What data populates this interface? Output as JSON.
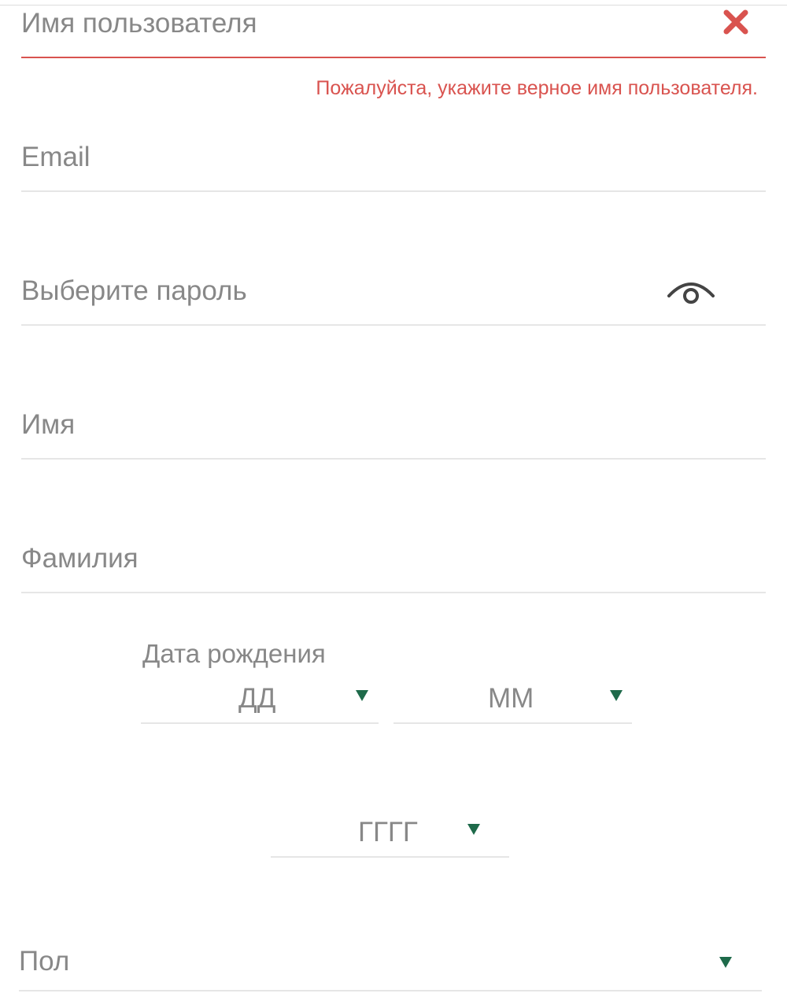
{
  "form": {
    "username": {
      "placeholder": "Имя пользователя",
      "error": "Пожалуйста, укажите верное имя пользователя."
    },
    "email": {
      "placeholder": "Email"
    },
    "password": {
      "placeholder": "Выберите пароль"
    },
    "first_name": {
      "placeholder": "Имя"
    },
    "last_name": {
      "placeholder": "Фамилия"
    },
    "dob": {
      "label": "Дата рождения",
      "day": "ДД",
      "month": "ММ",
      "year": "ГГГГ"
    },
    "gender": {
      "placeholder": "Пол"
    }
  },
  "icons": {
    "clear": "close-icon",
    "password_toggle": "eye-icon",
    "dropdown": "triangle-down-icon"
  },
  "colors": {
    "error": "#d9534f",
    "placeholder": "#888888",
    "caret": "#1e6a4a",
    "divider": "#e6e6e6"
  }
}
